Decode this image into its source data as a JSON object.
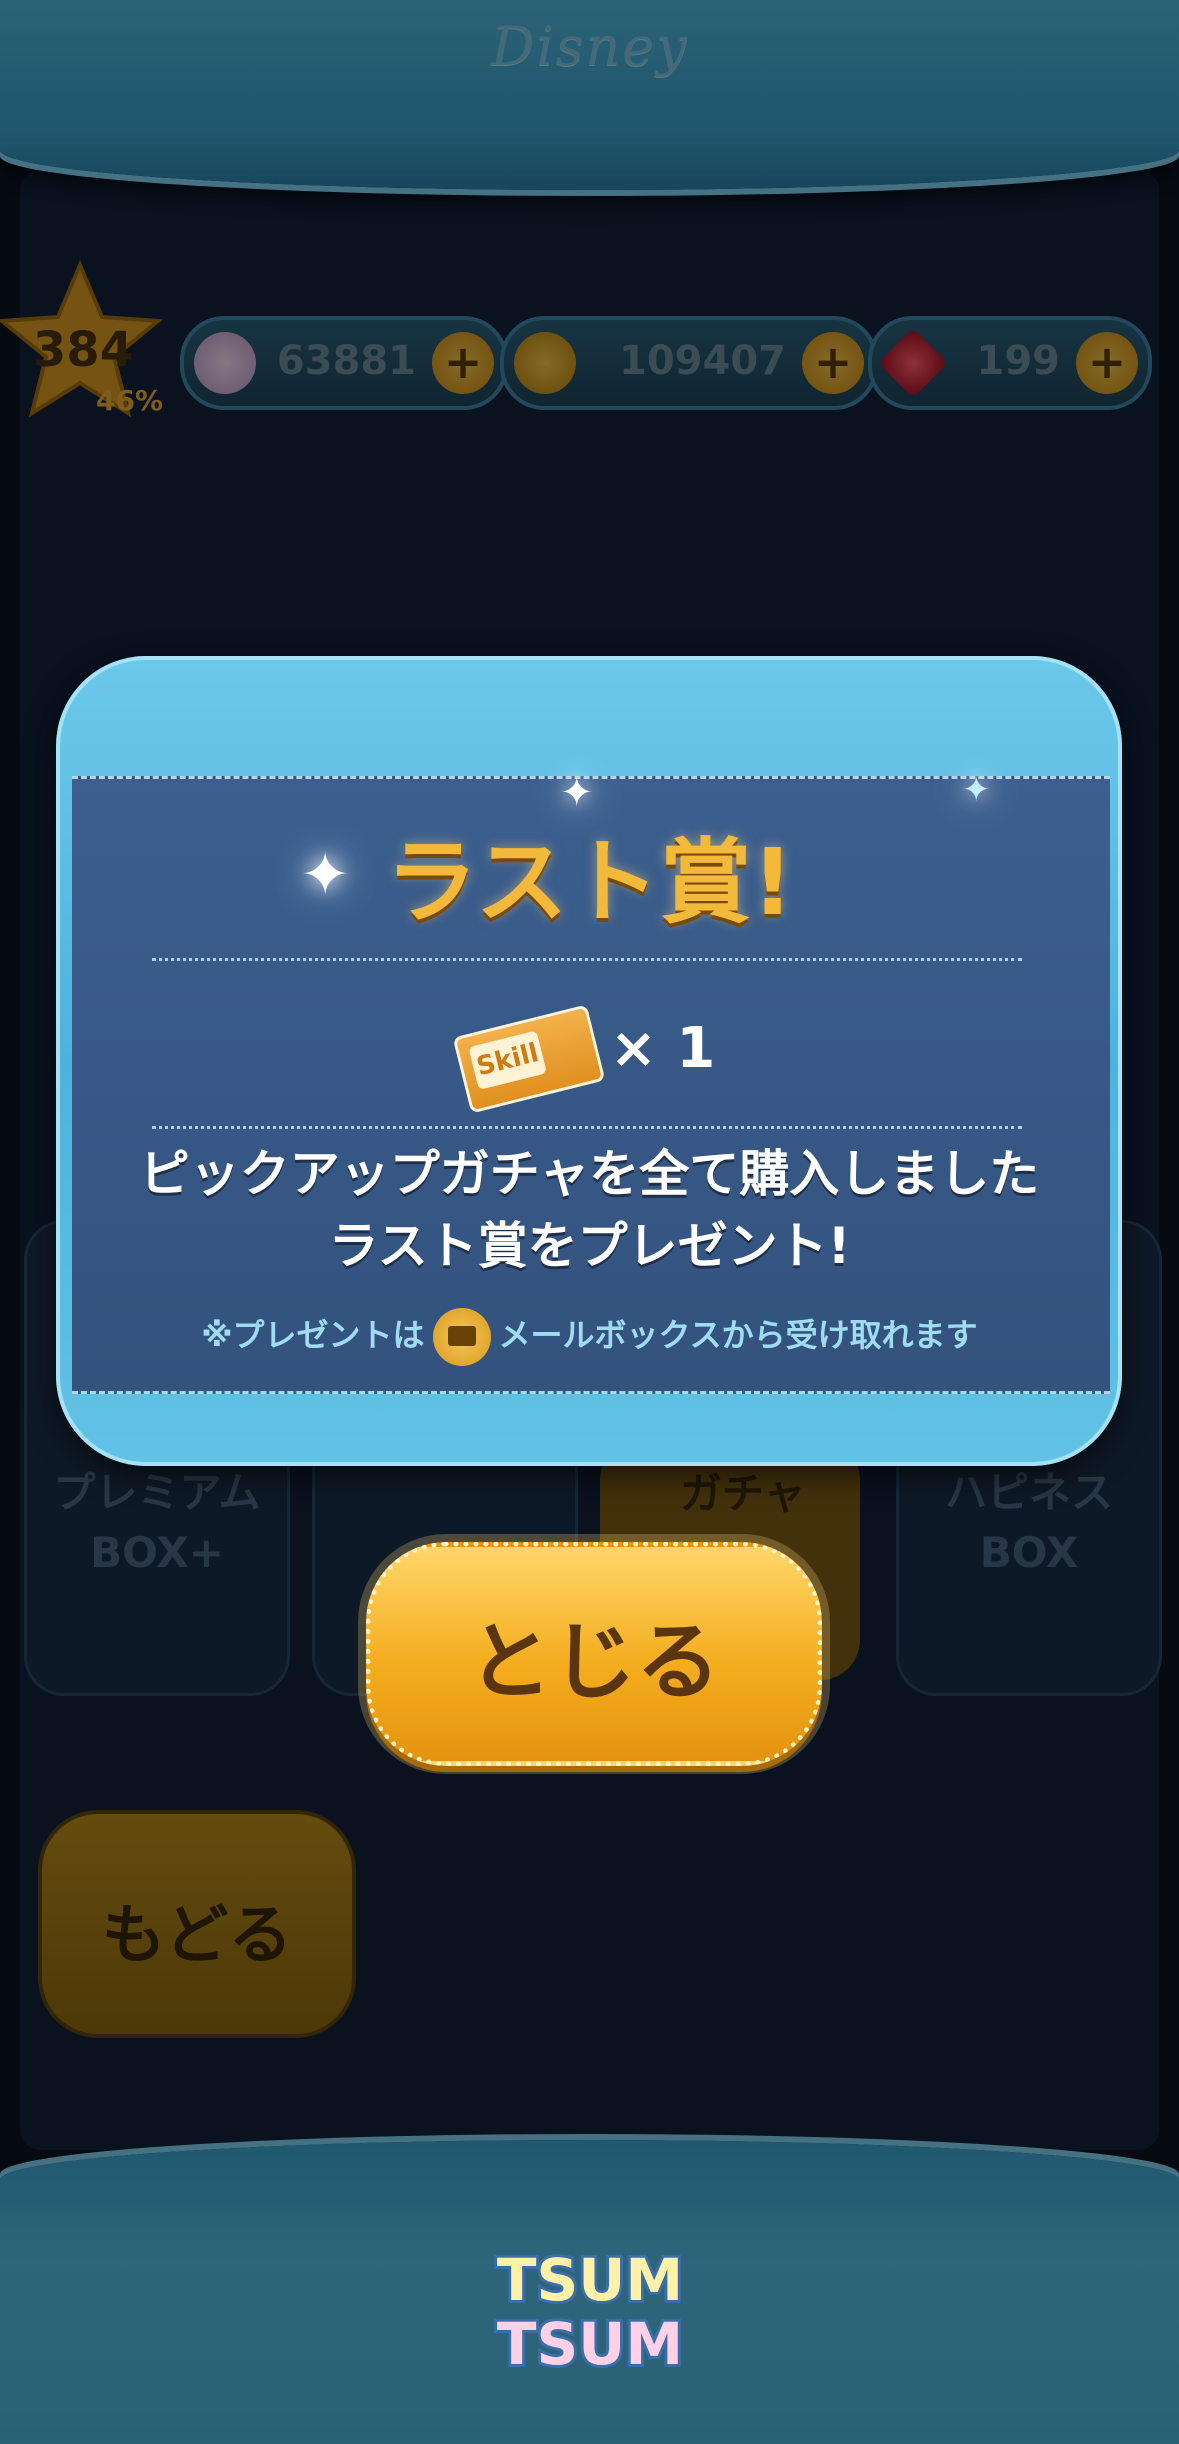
{
  "header": {
    "brand": "Disney"
  },
  "status": {
    "level": "384",
    "level_progress": "46%",
    "hearts_crystal": "63881",
    "coins": "109407",
    "rubies": "199"
  },
  "background": {
    "box_left": "プレミアム\nBOX+",
    "box_right": "ハピネス\nBOX",
    "gacha_label": "ガチャ",
    "back_label": "もどる"
  },
  "modal": {
    "title": "ラスト賞!",
    "reward_item": "Skill",
    "reward_qty": "× 1",
    "message_line1": "ピックアップガチャを全て購入しました",
    "message_line2": "ラスト賞をプレゼント!",
    "note_prefix": "※プレゼントは",
    "note_suffix": "メールボックスから受け取れます",
    "close_label": "とじる"
  },
  "footer": {
    "logo_line1": "TSUM",
    "logo_line2": "TSUM"
  },
  "colors": {
    "accent": "#f4ad1e",
    "frame": "#4eb3dc",
    "panel": "#3c5f8f"
  }
}
